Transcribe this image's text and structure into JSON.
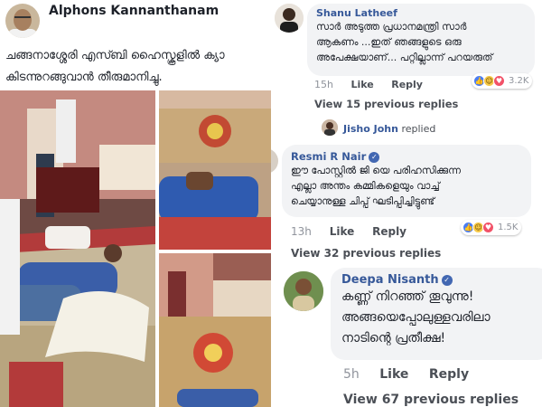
{
  "post": {
    "author": "Alphons Kannanthanam",
    "text_lines": [
      "ചങ്ങനാശ്ശേരി എസ്ബി ഹൈസ്കൂളിൽ ക്യാ",
      "കിടന്നുറങ്ങുവാൻ തീരുമാനിച്ചു."
    ]
  },
  "comments": [
    {
      "author": "Shanu Latheef",
      "verified": false,
      "lines": [
        "സാർ അടുത്ത പ്രധാനമന്ത്രി സാർ",
        "ആകണം ...ഇത് ഞങ്ങളുടെ ഒരു",
        "അപേക്ഷയാണ്... പറ്റില്ലാന്ന് പറയരുത്"
      ],
      "time": "15h",
      "like": "Like",
      "reply": "Reply",
      "reaction_count": "3.2K",
      "view_replies": "View 15 previous replies",
      "sub_reply": {
        "author": "Jisho John",
        "suffix": "replied"
      }
    },
    {
      "author": "Resmi R Nair",
      "verified": true,
      "lines": [
        "ഈ പോസ്റ്റിൽ ജി യെ പരിഹസിക്കുന്ന",
        "എല്ലാ അന്തം കമ്മികളെയും വാച്ച്",
        "ചെയ്യാനുള്ള ചിപ്പ് ഘടിപ്പിച്ചിട്ടുണ്ട്"
      ],
      "time": "13h",
      "like": "Like",
      "reply": "Reply",
      "reaction_count": "1.5K",
      "view_replies": "View 32 previous replies"
    },
    {
      "author": "Deepa Nisanth",
      "verified": true,
      "lines": [
        "കണ്ണ് നിറഞ്ഞ് തൂവുന്നു!",
        "അങ്ങയെപ്പോലുള്ളവരിലാ",
        "നാടിന്റെ പ്രതീക്ഷ!"
      ],
      "time": "5h",
      "like": "Like",
      "reply": "Reply",
      "view_replies": "View 67 previous replies"
    }
  ],
  "colors": {
    "name_blue": "#365899",
    "bubble_bg": "#f2f3f5",
    "meta_grey": "#90949c"
  }
}
